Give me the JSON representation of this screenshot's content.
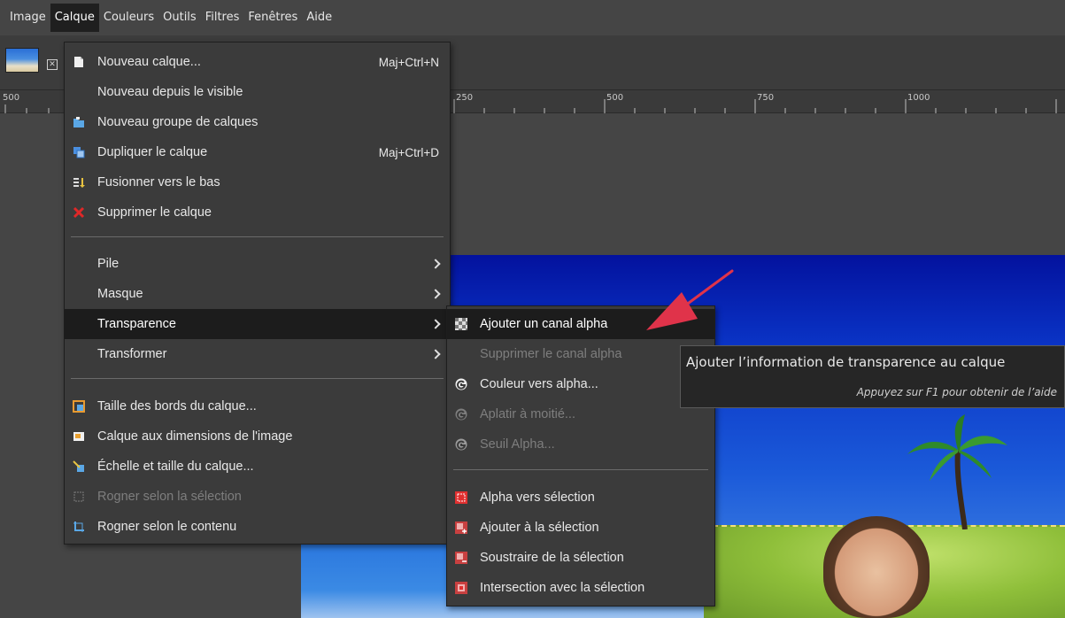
{
  "menubar": {
    "items": [
      {
        "label": "Image"
      },
      {
        "label": "Calque"
      },
      {
        "label": "Couleurs"
      },
      {
        "label": "Outils"
      },
      {
        "label": "Filtres"
      },
      {
        "label": "Fenêtres"
      },
      {
        "label": "Aide"
      }
    ],
    "active": "Calque"
  },
  "ruler": {
    "labels": [
      "500",
      "250",
      "500",
      "750",
      "1000"
    ]
  },
  "calque_menu": {
    "items": [
      {
        "label": "Nouveau calque...",
        "shortcut": "Maj+Ctrl+N",
        "icon": "new-layer-icon"
      },
      {
        "label": "Nouveau depuis le visible",
        "icon": ""
      },
      {
        "label": "Nouveau groupe de calques",
        "icon": "new-layer-group-icon"
      },
      {
        "label": "Dupliquer le calque",
        "shortcut": "Maj+Ctrl+D",
        "icon": "duplicate-layer-icon"
      },
      {
        "label": "Fusionner vers le bas",
        "icon": "merge-down-icon"
      },
      {
        "label": "Supprimer le calque",
        "icon": "delete-icon"
      },
      {
        "label": "Pile",
        "submenu": true
      },
      {
        "label": "Masque",
        "submenu": true
      },
      {
        "label": "Transparence",
        "submenu": true,
        "highlighted": true
      },
      {
        "label": "Transformer",
        "submenu": true
      },
      {
        "label": "Taille des bords du calque...",
        "icon": "layer-boundary-icon"
      },
      {
        "label": "Calque aux dimensions de l'image",
        "icon": "layer-to-image-size-icon"
      },
      {
        "label": "Échelle et taille du calque...",
        "icon": "scale-layer-icon"
      },
      {
        "label": "Rogner selon la sélection",
        "icon": "crop-to-selection-icon",
        "disabled": true
      },
      {
        "label": "Rogner selon le contenu",
        "icon": "crop-to-content-icon"
      }
    ]
  },
  "transparence_menu": {
    "items": [
      {
        "label": "Ajouter un canal alpha",
        "icon": "add-alpha-icon",
        "highlighted": true
      },
      {
        "label": "Supprimer le canal alpha",
        "disabled": true
      },
      {
        "label": "Couleur vers alpha...",
        "icon": "gegl-icon"
      },
      {
        "label": "Aplatir à moitié...",
        "icon": "gegl-icon",
        "disabled": true
      },
      {
        "label": "Seuil Alpha...",
        "icon": "gegl-icon",
        "disabled": true
      },
      {
        "label": "Alpha vers sélection",
        "icon": "alpha-to-selection-icon"
      },
      {
        "label": "Ajouter à la sélection",
        "icon": "add-to-selection-icon"
      },
      {
        "label": "Soustraire de la sélection",
        "icon": "subtract-from-selection-icon"
      },
      {
        "label": "Intersection avec la sélection",
        "icon": "intersect-selection-icon"
      }
    ]
  },
  "tooltip": {
    "title": "Ajouter l’information de transparence au calque",
    "hint": "Appuyez sur F1 pour obtenir de l’aide"
  },
  "colors": {
    "menu_bg": "#3b3b3b",
    "highlight_bg": "#1c1c1c",
    "annotation_arrow": "#e0334a"
  }
}
